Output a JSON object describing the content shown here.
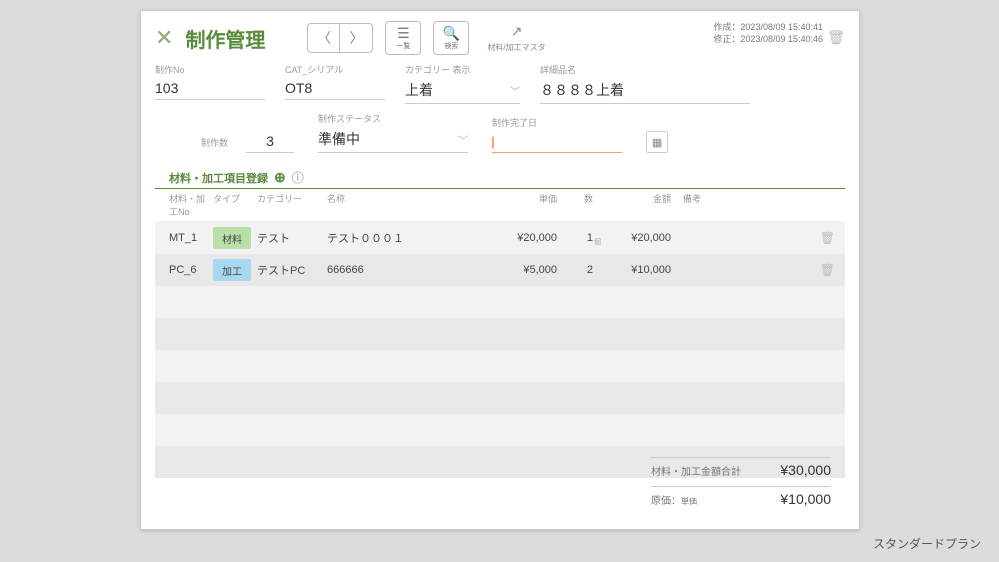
{
  "header": {
    "title": "制作管理",
    "list_label": "一覧",
    "search_label": "検索",
    "master_label": "材料/加工マスタ"
  },
  "meta": {
    "created_label": "作成：",
    "created_at": "2023/08/09 15:40:41",
    "updated_label": "修正：",
    "updated_at": "2023/08/09 15:40:46"
  },
  "form": {
    "no_label": "制作No",
    "no": "103",
    "cat_label": "CAT_シリアル",
    "cat": "OT8",
    "catdisp_label": "カテゴリー 表示",
    "catdisp": "上着",
    "name_label": "詳細品名",
    "name": "８８８８上着",
    "qty_label": "制作数",
    "qty": "3",
    "status_label": "制作ステータス",
    "status": "準備中",
    "date_label": "制作完了日",
    "date": ""
  },
  "section": {
    "title": "材料・加工項目登録"
  },
  "columns": {
    "no": "材料・加工No",
    "type": "タイプ",
    "cat": "カテゴリー",
    "name": "名称",
    "price": "単価",
    "qty": "数",
    "amt": "金額",
    "note": "備考",
    "qty_sub": "個"
  },
  "rows": [
    {
      "no": "MT_1",
      "type": "材料",
      "type_class": "chip-mat",
      "cat": "テスト",
      "name": "テスト０００１",
      "price": "¥20,000",
      "qty": "1",
      "amt": "¥20,000"
    },
    {
      "no": "PC_6",
      "type": "加工",
      "type_class": "chip-proc",
      "cat": "テストPC",
      "name": "666666",
      "price": "¥5,000",
      "qty": "2",
      "amt": "¥10,000"
    }
  ],
  "totals": {
    "sum_label": "材料・加工金額合計",
    "sum": "¥30,000",
    "cost_label": "原価：",
    "cost_sub": "単価",
    "cost": "¥10,000"
  },
  "footer": {
    "plan": "スタンダードプラン"
  }
}
